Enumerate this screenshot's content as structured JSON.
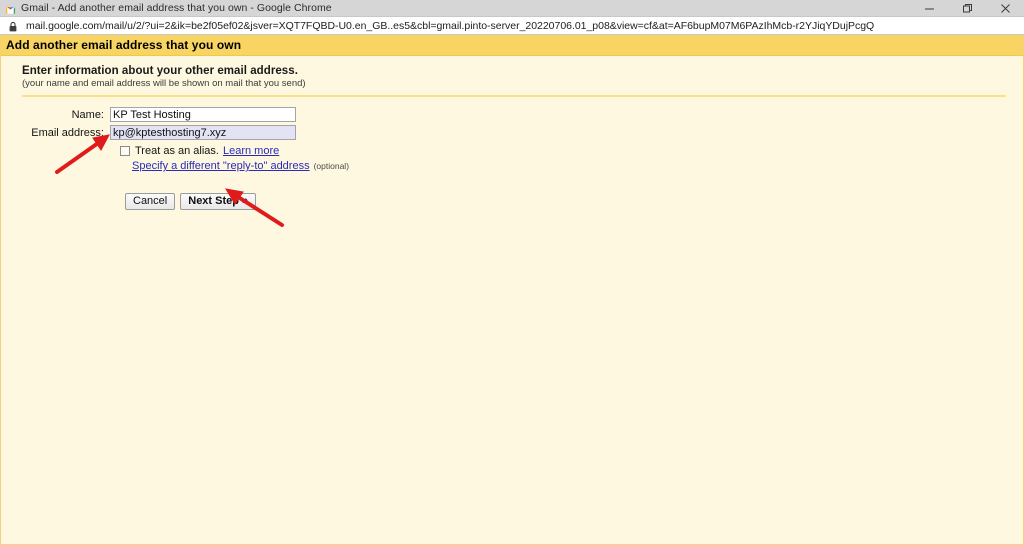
{
  "browser": {
    "tab": {
      "favicon": "gmail-logo-icon",
      "title": "Gmail - Add another email address that you own - Google Chrome"
    },
    "window_controls": {
      "minimize": "minimize-icon",
      "maximize": "restore-icon",
      "close": "close-icon"
    },
    "address_bar": {
      "lock_icon": "lock-icon",
      "url": "mail.google.com/mail/u/2/?ui=2&ik=be2f05ef02&jsver=XQT7FQBD-U0.en_GB..es5&cbl=gmail.pinto-server_20220706.01_p08&view=cf&at=AF6bupM07M6PAzIhMcb-r2YJiqYDujPcgQ"
    }
  },
  "page": {
    "header_title": "Add another email address that you own",
    "intro": {
      "title": "Enter information about your other email address.",
      "subtitle": "(your name and email address will be shown on mail that you send)"
    },
    "form": {
      "name": {
        "label": "Name:",
        "value": "KP Test Hosting",
        "placeholder": ""
      },
      "email": {
        "label": "Email address:",
        "value": "kp@kptesthosting7.xyz",
        "placeholder": ""
      },
      "alias": {
        "checked": false,
        "text": "Treat as an alias.",
        "learn_more": "Learn more"
      },
      "reply_to": {
        "link": "Specify a different \"reply-to\" address",
        "optional": "(optional)"
      }
    },
    "buttons": {
      "cancel": "Cancel",
      "next_step": "Next Step »"
    }
  },
  "annotations": [
    {
      "name": "arrow-to-alias-checkbox",
      "color": "#e01b1b"
    },
    {
      "name": "arrow-to-next-step-button",
      "color": "#e01b1b"
    }
  ],
  "colors": {
    "header_bg": "#f8d462",
    "page_bg": "#fdf8df",
    "link": "#2b2bbb",
    "arrow": "#e01b1b",
    "autofill": "#e2e3f5"
  }
}
